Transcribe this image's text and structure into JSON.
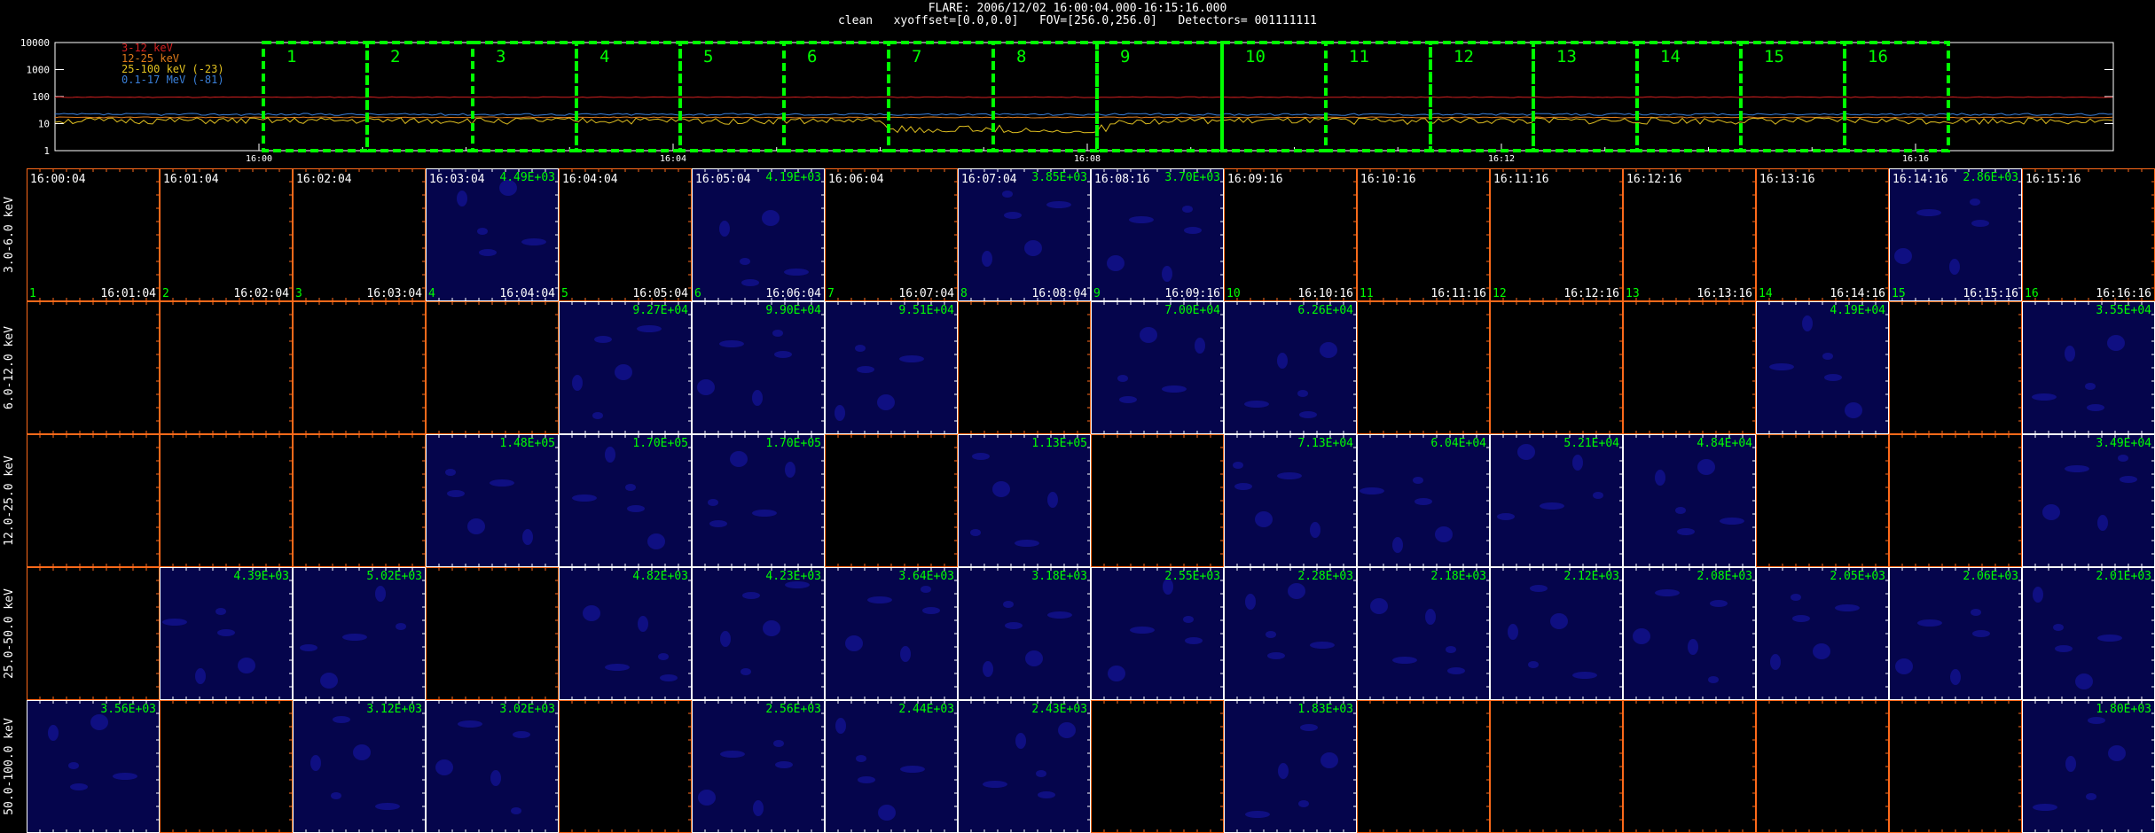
{
  "header": {
    "line1": "FLARE: 2006/12/02 16:00:04.000-16:15:16.000",
    "line2": "clean   xyoffset=[0.0,0.0]   FOV=[256.0,256.0]   Detectors= 001111111"
  },
  "colors": {
    "background": "#000000",
    "interval_box": "#00ff00",
    "time_text": "#ffffff",
    "value_text": "#00ff00",
    "index_text": "#00ff00",
    "frame_orange": "#ff6a1a",
    "frame_white": "#ffffff",
    "image_blue": "#0a0a8a"
  },
  "chart_data": [
    {
      "type": "line",
      "y_scale": "log",
      "ylim": [
        1,
        10000
      ],
      "y_ticks": [
        "10000",
        "1000",
        "100",
        "10",
        "1"
      ],
      "x_ticks": [
        "16:00",
        "16:04",
        "16:08",
        "16:12",
        "16:16"
      ],
      "legend": [
        {
          "name": "3-12 keV",
          "color": "#d42020"
        },
        {
          "name": "12-25 keV",
          "color": "#e07a1a"
        },
        {
          "name": "25-100 keV (-23)",
          "color": "#e0c020"
        },
        {
          "name": "0.1-17 MeV (-81)",
          "color": "#3a7fd8"
        }
      ],
      "intervals": [
        "1",
        "2",
        "3",
        "4",
        "5",
        "6",
        "7",
        "8",
        "9",
        "10",
        "11",
        "12",
        "13",
        "14",
        "15",
        "16"
      ]
    },
    {
      "type": "heatmap",
      "energy_bands": [
        "3.0-6.0 keV",
        "6.0-12.0 keV",
        "12.0-25.0 keV",
        "25.0-50.0 keV",
        "50.0-100.0 keV"
      ],
      "start_times": [
        "16:00:04",
        "16:01:04",
        "16:02:04",
        "16:03:04",
        "16:04:04",
        "16:05:04",
        "16:06:04",
        "16:07:04",
        "16:08:16",
        "16:09:16",
        "16:10:16",
        "16:11:16",
        "16:12:16",
        "16:13:16",
        "16:14:16",
        "16:15:16"
      ],
      "end_times": [
        "16:01:04",
        "16:02:04",
        "16:03:04",
        "16:04:04",
        "16:05:04",
        "16:06:04",
        "16:07:04",
        "16:08:04",
        "16:09:16",
        "16:10:16",
        "16:11:16",
        "16:12:16",
        "16:13:16",
        "16:14:16",
        "16:15:16",
        "16:16:16"
      ],
      "panel_indices": [
        "1",
        "2",
        "3",
        "4",
        "5",
        "6",
        "7",
        "8",
        "9",
        "10",
        "11",
        "12",
        "13",
        "14",
        "15",
        "16"
      ],
      "max_values": [
        [
          "",
          "",
          "",
          "4.49E+03",
          "",
          "4.19E+03",
          "",
          "3.85E+03",
          "3.70E+03",
          "",
          "",
          "",
          "",
          "",
          "2.86E+03",
          ""
        ],
        [
          "",
          "",
          "",
          "",
          "9.27E+04",
          "9.90E+04",
          "9.51E+04",
          "",
          "7.00E+04",
          "6.26E+04",
          "",
          "",
          "",
          "4.19E+04",
          "",
          "3.55E+04"
        ],
        [
          "",
          "",
          "",
          "1.48E+05",
          "1.70E+05",
          "1.70E+05",
          "",
          "1.13E+05",
          "",
          "7.13E+04",
          "6.04E+04",
          "5.21E+04",
          "4.84E+04",
          "",
          "",
          "3.49E+04"
        ],
        [
          "",
          "4.39E+03",
          "5.02E+03",
          "",
          "4.82E+03",
          "4.23E+03",
          "3.64E+03",
          "3.18E+03",
          "2.55E+03",
          "2.28E+03",
          "2.18E+03",
          "2.12E+03",
          "2.08E+03",
          "2.05E+03",
          "2.06E+03",
          "2.01E+03"
        ],
        [
          "3.56E+03",
          "",
          "3.12E+03",
          "3.02E+03",
          "",
          "2.56E+03",
          "2.44E+03",
          "2.43E+03",
          "",
          "1.83E+03",
          "",
          "",
          "",
          "",
          "",
          "1.80E+03"
        ]
      ]
    }
  ]
}
